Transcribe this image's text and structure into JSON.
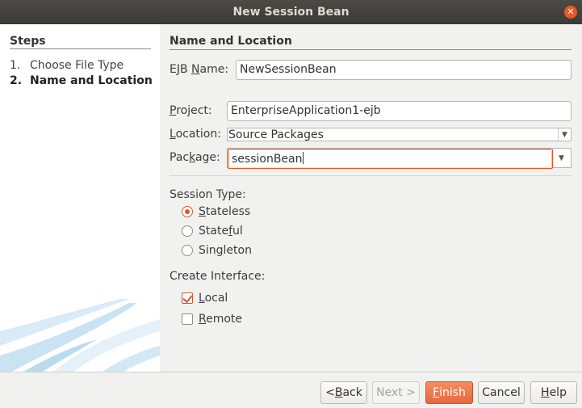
{
  "window": {
    "title": "New Session Bean"
  },
  "steps": {
    "title": "Steps",
    "items": [
      {
        "num": "1.",
        "label": "Choose File Type"
      },
      {
        "num": "2.",
        "label": "Name and Location"
      }
    ]
  },
  "main": {
    "title": "Name and Location",
    "ejb_name": {
      "label_pre": "EJB ",
      "label_mn": "N",
      "label_post": "ame:",
      "value": "NewSessionBean"
    },
    "project": {
      "label_pre": "",
      "label_mn": "P",
      "label_post": "roject:",
      "value": "EnterpriseApplication1-ejb"
    },
    "location": {
      "label_pre": "",
      "label_mn": "L",
      "label_post": "ocation:",
      "value": "Source Packages"
    },
    "package": {
      "label_pre": "Pac",
      "label_mn": "k",
      "label_post": "age:",
      "value": "sessionBean"
    },
    "session_type": {
      "label": "Session Type:",
      "options": [
        {
          "pre": "",
          "mn": "S",
          "post": "tateless",
          "checked": true
        },
        {
          "pre": "State",
          "mn": "f",
          "post": "ul",
          "checked": false
        },
        {
          "pre": "Sin",
          "mn": "g",
          "post": "leton",
          "checked": false
        }
      ]
    },
    "create_interface": {
      "label": "Create Interface:",
      "options": [
        {
          "pre": "",
          "mn": "L",
          "post": "ocal",
          "checked": true
        },
        {
          "pre": "",
          "mn": "R",
          "post": "emote",
          "checked": false
        }
      ]
    }
  },
  "buttons": {
    "back": {
      "pre": "< ",
      "mn": "B",
      "post": "ack"
    },
    "next": "Next >",
    "finish": {
      "pre": "",
      "mn": "F",
      "post": "inish"
    },
    "cancel": "Cancel",
    "help": {
      "pre": "",
      "mn": "H",
      "post": "elp"
    }
  },
  "colors": {
    "accent": "#e95420",
    "titlebar": "#3f3e3a",
    "panel": "#ffffff",
    "background": "#f1f1ef"
  }
}
